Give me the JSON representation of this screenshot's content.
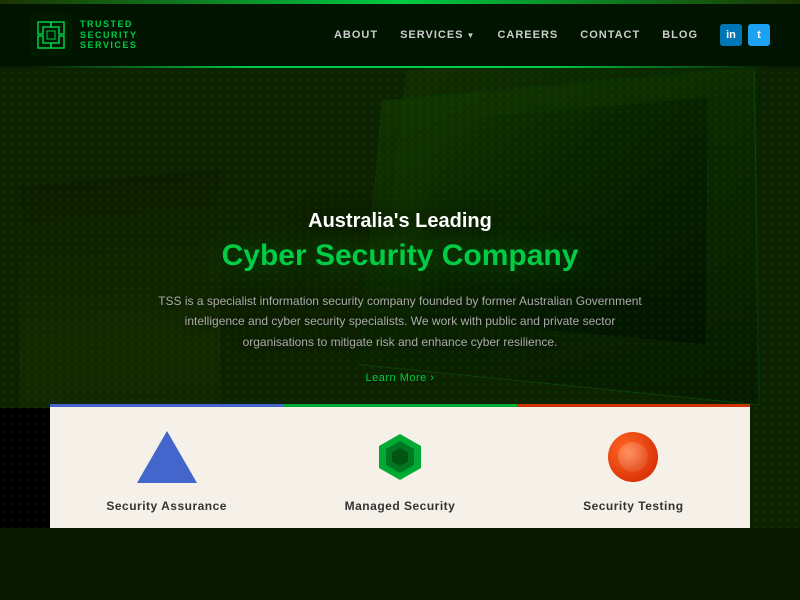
{
  "topBar": {},
  "header": {
    "logo": {
      "text1": "TRUSTED",
      "text2": "SECURITY",
      "text3": "SERVICES"
    },
    "nav": {
      "about": "ABOUT",
      "services": "SERVICES",
      "careers": "CAREERS",
      "contact": "CONTACT",
      "blog": "BLOG"
    },
    "social": {
      "linkedin": "in",
      "twitter": "t"
    }
  },
  "hero": {
    "subtitle": "Australia's Leading",
    "title": "Cyber Security Company",
    "description": "TSS is a specialist information security company founded by former Australian Government intelligence and cyber security specialists. We work with public and private sector organisations to mitigate risk and enhance cyber resilience.",
    "learnMore": "Learn More ›"
  },
  "cards": [
    {
      "label": "Security Assurance",
      "iconType": "triangle",
      "borderColor": "#4466cc"
    },
    {
      "label": "Managed Security",
      "iconType": "hex",
      "borderColor": "#00aa33"
    },
    {
      "label": "Security Testing",
      "iconType": "circle",
      "borderColor": "#cc3300"
    }
  ]
}
